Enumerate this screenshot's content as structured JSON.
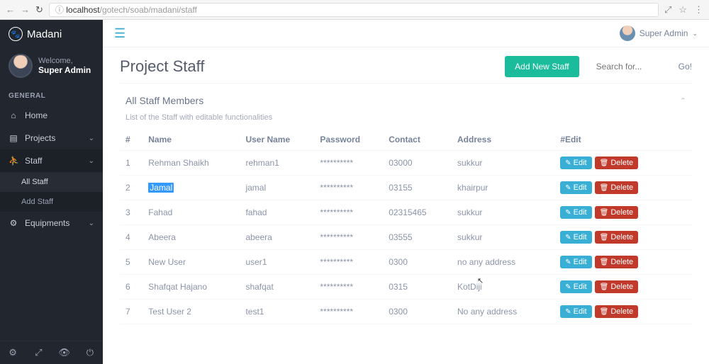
{
  "browser": {
    "url_host": "localhost",
    "url_path": "/gotech/soab/madani/staff"
  },
  "brand": {
    "name": "Madani"
  },
  "user": {
    "welcome": "Welcome,",
    "name": "Super Admin"
  },
  "topbar": {
    "user_label": "Super Admin"
  },
  "sidebar": {
    "section_label": "GENERAL",
    "items": [
      {
        "label": "Home"
      },
      {
        "label": "Projects"
      },
      {
        "label": "Staff"
      },
      {
        "label": "Equipments"
      }
    ],
    "staff_sub": [
      {
        "label": "All Staff"
      },
      {
        "label": "Add Staff"
      }
    ]
  },
  "page": {
    "title": "Project Staff",
    "add_button": "Add New Staff",
    "search_placeholder": "Search for...",
    "go_label": "Go!"
  },
  "panel": {
    "title": "All Staff Members",
    "subtitle": "List of the Staff with editable functionalities"
  },
  "table": {
    "headers": {
      "num": "#",
      "name": "Name",
      "username": "User Name",
      "password": "Password",
      "contact": "Contact",
      "address": "Address",
      "edit": "#Edit"
    },
    "password_mask": "**********",
    "edit_label": "Edit",
    "delete_label": "Delete",
    "rows": [
      {
        "num": "1",
        "name": "Rehman Shaikh",
        "username": "rehman1",
        "contact": "03000",
        "address": "sukkur"
      },
      {
        "num": "2",
        "name": "Jamal",
        "username": "jamal",
        "contact": "03155",
        "address": "khairpur"
      },
      {
        "num": "3",
        "name": "Fahad",
        "username": "fahad",
        "contact": "02315465",
        "address": "sukkur"
      },
      {
        "num": "4",
        "name": "Abeera",
        "username": "abeera",
        "contact": "03555",
        "address": "sukkur"
      },
      {
        "num": "5",
        "name": "New User",
        "username": "user1",
        "contact": "0300",
        "address": "no any address"
      },
      {
        "num": "6",
        "name": "Shafqat Hajano",
        "username": "shafqat",
        "contact": "0315",
        "address": "KotDiji"
      },
      {
        "num": "7",
        "name": "Test User 2",
        "username": "test1",
        "contact": "0300",
        "address": "No any address"
      }
    ]
  }
}
